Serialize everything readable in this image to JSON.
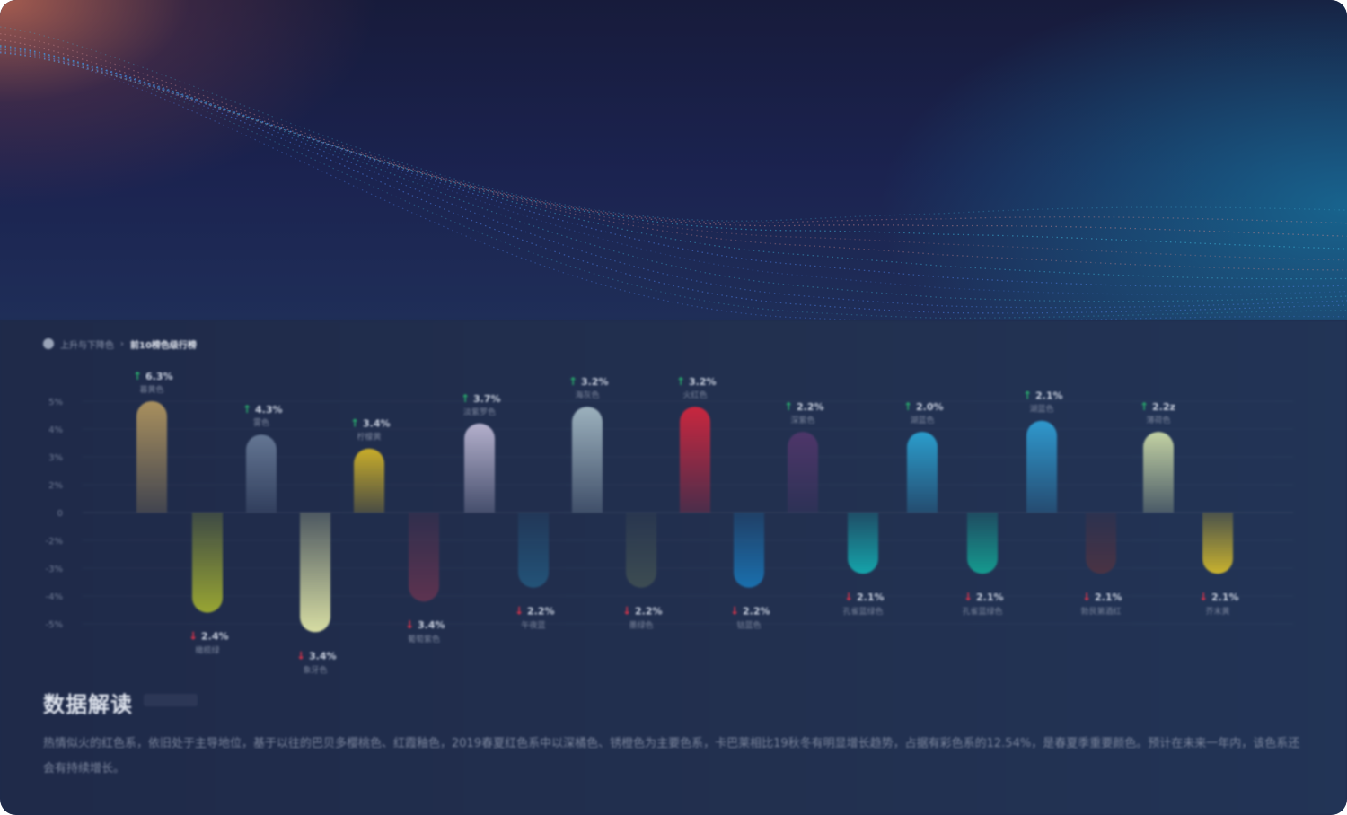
{
  "breadcrumb": {
    "parent": "上升与下降色",
    "current": "前10榜色级行榜",
    "icon": "location-pin-icon"
  },
  "chart_data": {
    "type": "bar",
    "y_tick_labels": [
      "5%",
      "4%",
      "3%",
      "2%",
      "0",
      "-2%",
      "-3%",
      "-4%",
      "-5%"
    ],
    "ylim": [
      -5,
      5
    ],
    "grid": true,
    "rising": [
      {
        "name": "暮黄色",
        "label": "6.3%",
        "value": 4.0,
        "color": "#a9905e"
      },
      {
        "name": "雾色",
        "label": "4.3%",
        "value": 2.8,
        "color": "#647693"
      },
      {
        "name": "柠檬黄",
        "label": "3.4%",
        "value": 2.3,
        "color": "#c9ad2a"
      },
      {
        "name": "淡紫罗色",
        "label": "3.7%",
        "value": 3.2,
        "color": "#b4b0cc"
      },
      {
        "name": "海灰色",
        "label": "3.2%",
        "value": 3.8,
        "color": "#9cb1bd"
      },
      {
        "name": "火红色",
        "label": "3.2%",
        "value": 3.8,
        "color": "#c8273f"
      },
      {
        "name": "深紫色",
        "label": "2.2%",
        "value": 2.9,
        "color": "#4e3669"
      },
      {
        "name": "湖蓝色",
        "label": "2.0%",
        "value": 2.9,
        "color": "#2b9dcc"
      },
      {
        "name": "湖蓝色",
        "label": "2.1%",
        "value": 3.3,
        "color": "#2f98cd"
      },
      {
        "name": "薄荷色",
        "label": "2.2z",
        "value": 2.9,
        "color": "#c3d2a3"
      }
    ],
    "falling": [
      {
        "name": "橄榄绿",
        "label": "2.4%",
        "value": -3.6,
        "color": "#98a533"
      },
      {
        "name": "象牙色",
        "label": "3.4%",
        "value": -4.3,
        "color": "#d7dda3"
      },
      {
        "name": "葡萄紫色",
        "label": "3.4%",
        "value": -3.2,
        "color": "#5d3350"
      },
      {
        "name": "午夜蓝",
        "label": "2.2%",
        "value": -2.7,
        "color": "#235378"
      },
      {
        "name": "墨绿色",
        "label": "2.2%",
        "value": -2.7,
        "color": "#3d4c52"
      },
      {
        "name": "钴蓝色",
        "label": "2.2%",
        "value": -2.7,
        "color": "#1a6fad"
      },
      {
        "name": "孔雀蓝绿色",
        "label": "2.1%",
        "value": -2.2,
        "color": "#15a4aa"
      },
      {
        "name": "孔雀蓝绿色",
        "label": "2.1%",
        "value": -2.2,
        "color": "#159a8f"
      },
      {
        "name": "勃艮第酒红",
        "label": "2.1%",
        "value": -2.2,
        "color": "#4a3344"
      },
      {
        "name": "芥末黄",
        "label": "2.1%",
        "value": -2.2,
        "color": "#c8b22f"
      }
    ],
    "up_color": "#29b06e",
    "down_color": "#e0344a"
  },
  "analysis": {
    "title": "数据解读",
    "text": "热情似火的红色系，依旧处于主导地位，基于以往的巴贝多樱桃色、红霞釉色，2019春夏红色系中以深橘色、锈橙色为主要色系，卡巴莱相比19秋冬有明显增长趋势，占据有彩色系的12.54%，是春夏季重要颜色。预计在未来一年内，该色系还会有持续增长。"
  }
}
